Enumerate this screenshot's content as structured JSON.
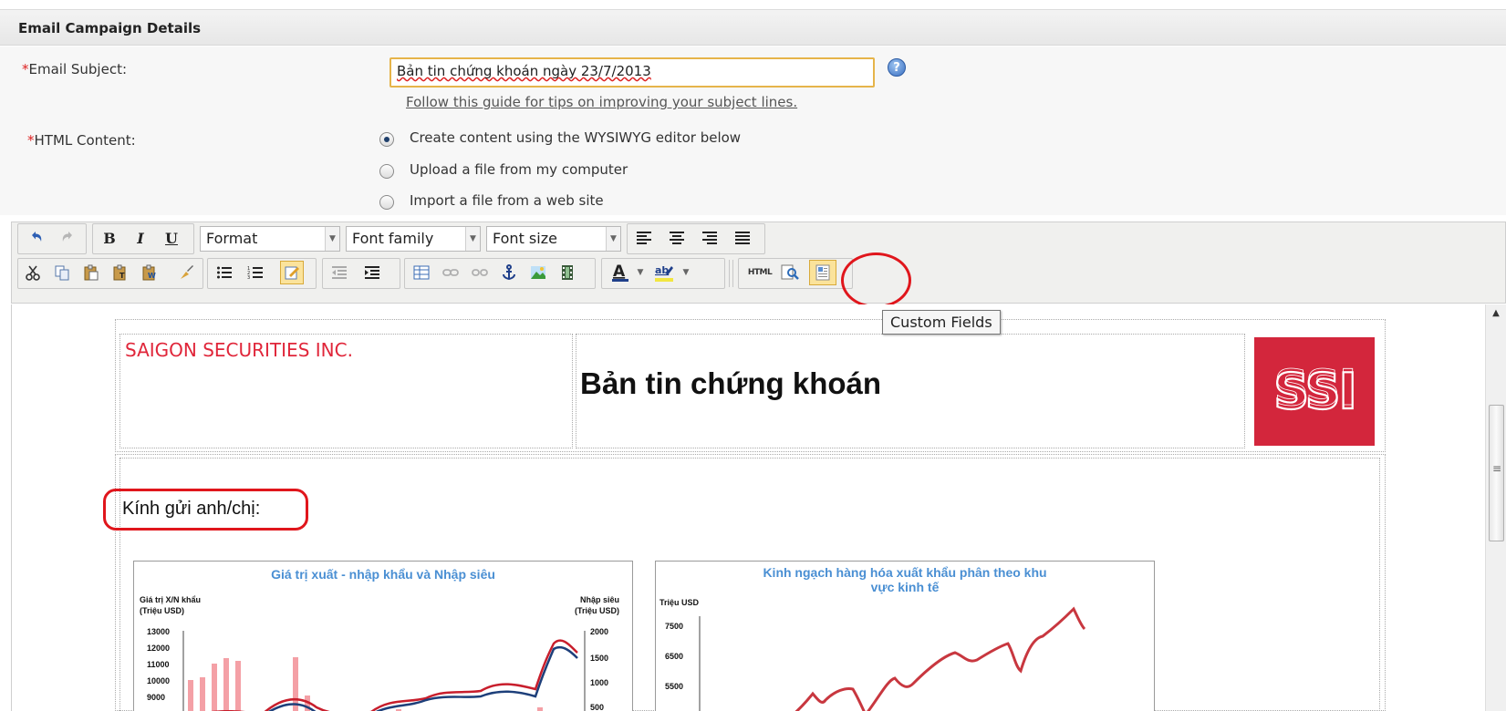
{
  "panel": {
    "title": "Email Campaign Details"
  },
  "form": {
    "subject": {
      "required_mark": "*",
      "label": "Email Subject:",
      "value": "Bản tin chứng khoán ngày 23/7/2013",
      "help_icon": "help-icon",
      "guide_link": "Follow this guide for tips on improving your subject lines."
    },
    "html_content": {
      "required_mark": "*",
      "label": "HTML Content:",
      "options": [
        {
          "label": "Create content using the WYSIWYG editor below",
          "checked": true
        },
        {
          "label": "Upload a file from my computer",
          "checked": false
        },
        {
          "label": "Import a file from a web site",
          "checked": false
        }
      ]
    }
  },
  "toolbar": {
    "row1": {
      "undo": "undo-icon",
      "redo": "redo-icon",
      "bold": "B",
      "italic": "I",
      "underline": "U",
      "format": "Format",
      "font_family": "Font family",
      "font_size": "Font size"
    },
    "row2": {
      "html_label": "HTML"
    },
    "tooltip": "Custom Fields"
  },
  "colors": {
    "accent_red": "#d3263c",
    "chart_blue": "#4a8fd3",
    "annotation_red": "#e0161c"
  },
  "editor": {
    "company": "SAIGON SECURITIES INC.",
    "headline": "Bản tin chứng khoán",
    "logo_text": "SSI",
    "greeting": "Kính gửi anh/chị:",
    "charts": [
      {
        "title": "Giá trị xuất - nhập khẩu và Nhập siêu",
        "left_axis_label": [
          "Giá trị X/N khẩu",
          "(Triệu USD)"
        ],
        "right_axis_label": [
          "Nhập siêu",
          "(Triệu USD)"
        ],
        "left_ticks": [
          "13000",
          "12000",
          "11000",
          "10000",
          "9000"
        ],
        "right_ticks": [
          "2000",
          "1500",
          "1000",
          "500"
        ]
      },
      {
        "title": [
          "Kinh ngạch hàng hóa xuất khẩu phân theo khu",
          "vực kinh tế"
        ],
        "axis_label": "Triệu USD",
        "ticks": [
          "7500",
          "6500",
          "5500"
        ]
      }
    ]
  }
}
